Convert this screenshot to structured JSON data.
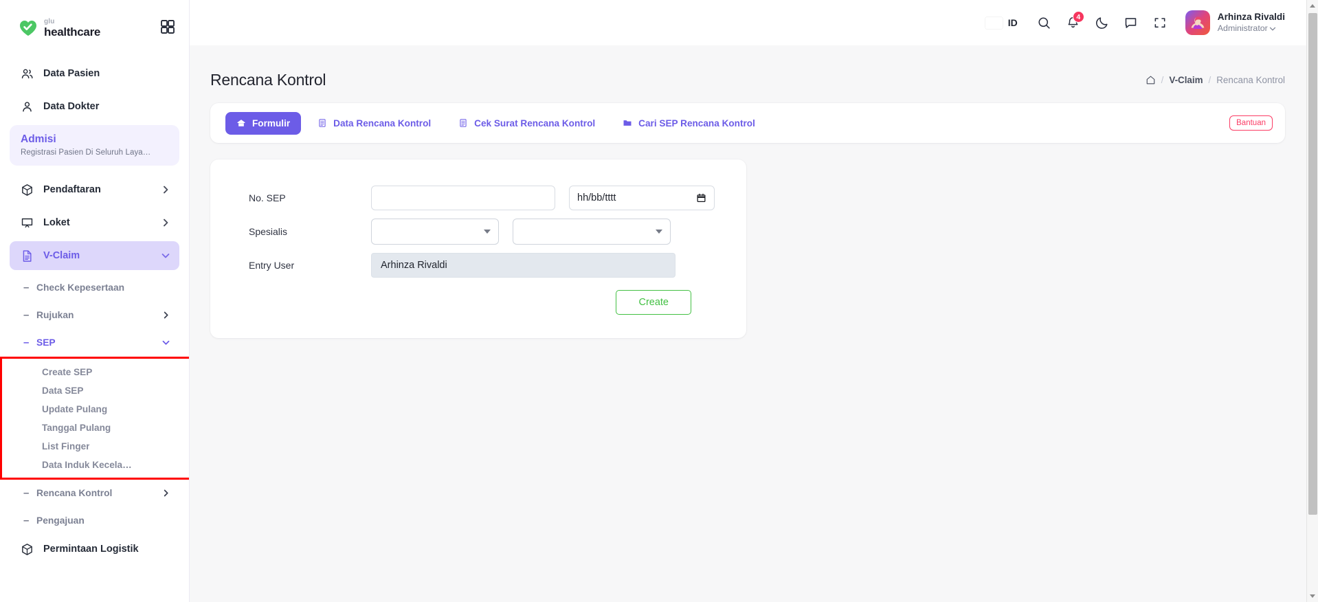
{
  "brand": {
    "sub": "glu",
    "main": "healthcare",
    "grid_icon": "grid-icon"
  },
  "sidebar": {
    "items": [
      {
        "label": "Data Pasien",
        "icon": "users-icon"
      },
      {
        "label": "Data Dokter",
        "icon": "user-icon"
      }
    ],
    "promo_card": {
      "title": "Admisi",
      "subtitle": "Registrasi Pasien Di Seluruh Laya…"
    },
    "groups": [
      {
        "label": "Pendaftaran",
        "icon": "box-icon",
        "chevron": "chevron-right-icon"
      },
      {
        "label": "Loket",
        "icon": "monitor-icon",
        "chevron": "chevron-right-icon"
      }
    ],
    "vclaim": {
      "label": "V-Claim",
      "icon": "document-icon",
      "chevron": "chevron-down-icon"
    },
    "vclaim_children": [
      {
        "label": "Check Kepesertaan",
        "has_chevron": false
      },
      {
        "label": "Rujukan",
        "has_chevron": true
      },
      {
        "label": "SEP",
        "has_chevron": true,
        "active": true
      }
    ],
    "sep_children": [
      {
        "label": "Create SEP"
      },
      {
        "label": "Data SEP"
      },
      {
        "label": "Update Pulang"
      },
      {
        "label": "Tanggal Pulang"
      },
      {
        "label": "List Finger"
      },
      {
        "label": "Data Induk Kecela…"
      }
    ],
    "vclaim_children_after": [
      {
        "label": "Rencana Kontrol",
        "has_chevron": true
      },
      {
        "label": "Pengajuan",
        "has_chevron": false
      }
    ],
    "footer_items": [
      {
        "label": "Permintaan Logistik",
        "icon": "box-icon"
      }
    ]
  },
  "header": {
    "language": {
      "code": "ID",
      "flag": "indonesia-flag-icon"
    },
    "search_icon": "search-icon",
    "notifications": {
      "icon": "bell-icon",
      "count": "4"
    },
    "theme_icon": "moon-icon",
    "chat_icon": "chat-icon",
    "fullscreen_icon": "fullscreen-icon",
    "user": {
      "name": "Arhinza Rivaldi",
      "role": "Administrator",
      "avatar": "avatar",
      "chevron": "chevron-down-icon"
    }
  },
  "page": {
    "title": "Rencana Kontrol",
    "breadcrumb": {
      "home_icon": "home-icon",
      "items": [
        "V-Claim",
        "Rencana Kontrol"
      ],
      "separator": "/"
    }
  },
  "tabs": [
    {
      "label": "Formulir",
      "icon": "home-icon",
      "active": true
    },
    {
      "label": "Data Rencana Kontrol",
      "icon": "list-icon",
      "active": false
    },
    {
      "label": "Cek Surat Rencana Kontrol",
      "icon": "list-icon",
      "active": false
    },
    {
      "label": "Cari SEP Rencana Kontrol",
      "icon": "folder-icon",
      "active": false
    }
  ],
  "help_badge": "Bantuan",
  "form": {
    "fields": {
      "no_sep": {
        "label": "No. SEP",
        "value": "",
        "placeholder": ""
      },
      "date": {
        "placeholder": "hh/bb/tttt",
        "icon": "calendar-icon"
      },
      "spesialis": {
        "label": "Spesialis",
        "select1": "",
        "select2": ""
      },
      "entry_user": {
        "label": "Entry User",
        "value": "Arhinza Rivaldi"
      }
    },
    "submit": "Create"
  },
  "colors": {
    "accent": "#6c5ce7",
    "accent_soft": "#ddd7fb",
    "accent_card": "#f3f1fe",
    "success": "#43c043",
    "danger": "#fb3b64",
    "annotation": "#ff0000"
  }
}
